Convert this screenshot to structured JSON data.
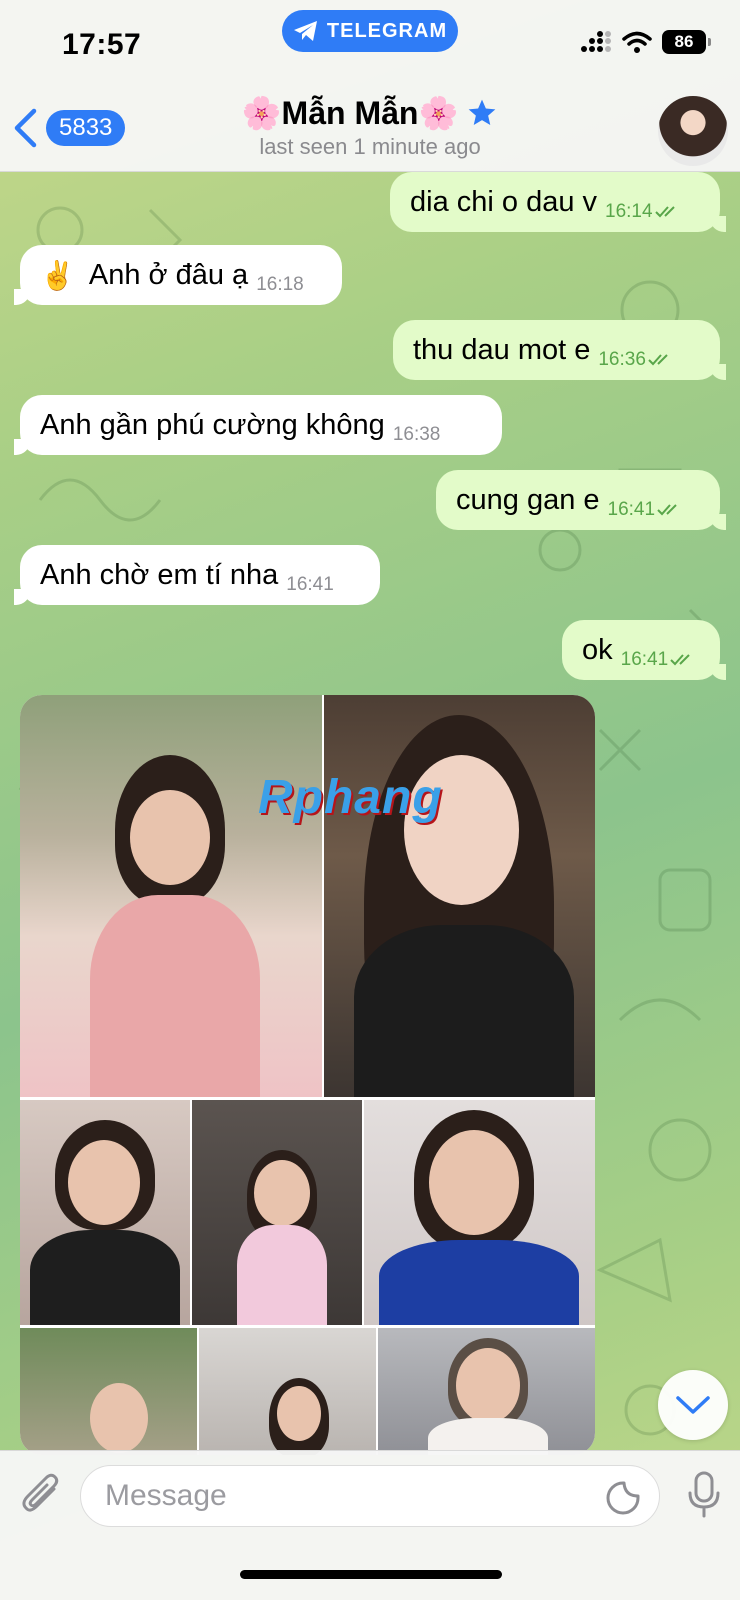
{
  "status_bar": {
    "time": "17:57",
    "app_pill": "TELEGRAM",
    "battery": "86"
  },
  "header": {
    "back_count": "5833",
    "name": "🌸Mẫn Mẫn🌸",
    "subtitle": "last seen 1 minute ago"
  },
  "messages": [
    {
      "dir": "out",
      "text": "dia chi o dau v",
      "time": "16:14"
    },
    {
      "dir": "in",
      "emoji": "✌️",
      "text": "Anh ở đâu ạ",
      "time": "16:18"
    },
    {
      "dir": "out",
      "text": "thu dau mot e",
      "time": "16:36"
    },
    {
      "dir": "in",
      "text": "Anh gần phú cường không",
      "time": "16:38"
    },
    {
      "dir": "out",
      "text": "cung gan e",
      "time": "16:41"
    },
    {
      "dir": "in",
      "text": "Anh chờ em tí nha",
      "time": "16:41"
    },
    {
      "dir": "out",
      "text": "ok",
      "time": "16:41"
    }
  ],
  "album": {
    "photo_count": 8,
    "watermark": "Rphang"
  },
  "input": {
    "placeholder": "Message"
  },
  "colors": {
    "accent": "#2f7cf6",
    "outgoing_bubble": "#e3fbc9",
    "incoming_bubble": "#ffffff",
    "read_check": "#59a64a"
  }
}
